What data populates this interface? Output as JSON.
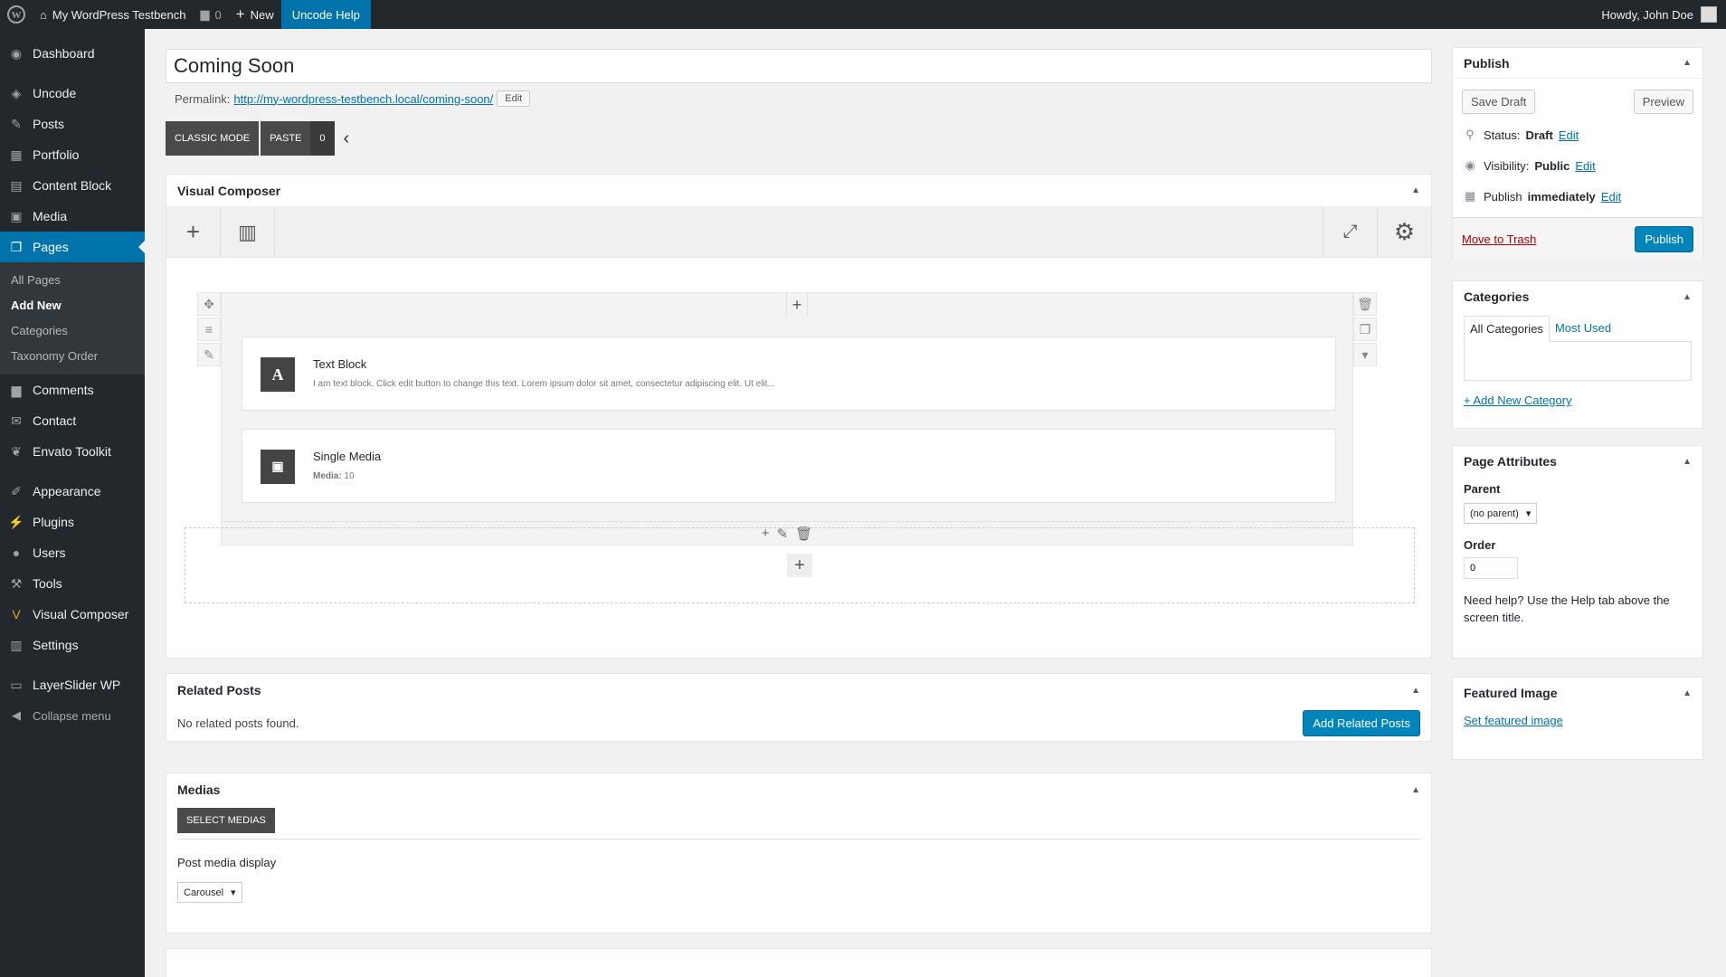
{
  "admin_bar": {
    "site_name": "My WordPress Testbench",
    "comments_count": "0",
    "new_label": "New",
    "help_label": "Uncode Help",
    "howdy": "Howdy, John Doe"
  },
  "sidebar": {
    "items": [
      {
        "label": "Dashboard",
        "icon": "dashboard-icon"
      },
      {
        "label": "Uncode",
        "icon": "layers-icon"
      },
      {
        "label": "Posts",
        "icon": "pin-icon"
      },
      {
        "label": "Portfolio",
        "icon": "grid-icon"
      },
      {
        "label": "Content Block",
        "icon": "blocks-icon"
      },
      {
        "label": "Media",
        "icon": "media-icon"
      },
      {
        "label": "Pages",
        "icon": "pages-icon"
      },
      {
        "label": "Comments",
        "icon": "comment-icon"
      },
      {
        "label": "Contact",
        "icon": "mail-icon"
      },
      {
        "label": "Envato Toolkit",
        "icon": "leaf-icon"
      },
      {
        "label": "Appearance",
        "icon": "brush-icon"
      },
      {
        "label": "Plugins",
        "icon": "plug-icon"
      },
      {
        "label": "Users",
        "icon": "user-icon"
      },
      {
        "label": "Tools",
        "icon": "wrench-icon"
      },
      {
        "label": "Visual Composer",
        "icon": "vc-icon"
      },
      {
        "label": "Settings",
        "icon": "settings-icon"
      },
      {
        "label": "LayerSlider WP",
        "icon": "slider-icon"
      },
      {
        "label": "Collapse menu",
        "icon": "collapse-icon"
      }
    ],
    "pages_sub": [
      "All Pages",
      "Add New",
      "Categories",
      "Taxonomy Order"
    ]
  },
  "editor": {
    "title_value": "Coming Soon",
    "permalink_label": "Permalink:",
    "permalink_url": "http://my-wordpress-testbench.local/coming-soon/",
    "permalink_edit": "Edit",
    "classic_mode": "CLASSIC MODE",
    "paste": "PASTE",
    "paste_count": "0"
  },
  "visual_composer": {
    "title": "Visual Composer",
    "elements": [
      {
        "title": "Text Block",
        "icon_letter": "A",
        "desc": "I am text block. Click edit button to change this text. Lorem ipsum dolor sit amet, consectetur adipiscing elit. Ut elit..."
      },
      {
        "title": "Single Media",
        "desc_label": "Media:",
        "desc_value": "10"
      }
    ]
  },
  "related_posts": {
    "title": "Related Posts",
    "empty_text": "No related posts found.",
    "add_button": "Add Related Posts"
  },
  "medias": {
    "title": "Medias",
    "select_button": "SELECT MEDIAS",
    "display_label": "Post media display",
    "display_value": "Carousel"
  },
  "publish": {
    "title": "Publish",
    "save_draft": "Save Draft",
    "preview": "Preview",
    "status_label": "Status:",
    "status_value": "Draft",
    "visibility_label": "Visibility:",
    "visibility_value": "Public",
    "publish_label": "Publish",
    "publish_value": "immediately",
    "edit": "Edit",
    "move_to_trash": "Move to Trash",
    "publish_button": "Publish"
  },
  "categories": {
    "title": "Categories",
    "tab_all": "All Categories",
    "tab_used": "Most Used",
    "add_new": "+ Add New Category"
  },
  "page_attributes": {
    "title": "Page Attributes",
    "parent_label": "Parent",
    "parent_value": "(no parent)",
    "order_label": "Order",
    "order_value": "0",
    "help_text": "Need help? Use the Help tab above the screen title."
  },
  "featured_image": {
    "title": "Featured Image",
    "link": "Set featured image"
  },
  "colors": {
    "accent": "#0073aa",
    "sidebar_bg": "#23282d",
    "primary_button": "#0085ba",
    "trash_link": "#a00"
  }
}
